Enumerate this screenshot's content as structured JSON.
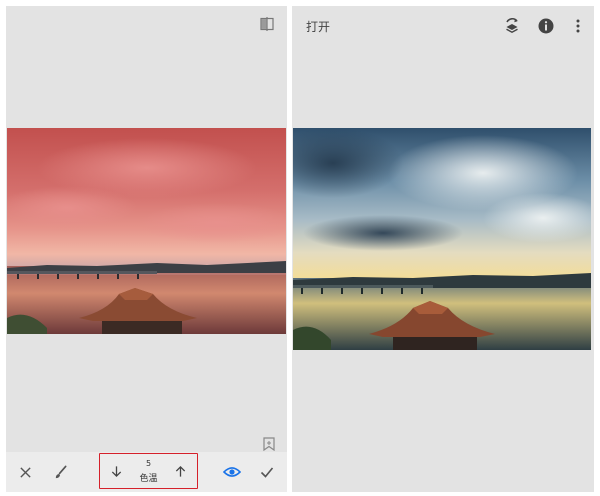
{
  "left_panel": {
    "tool": {
      "value": "5",
      "label": "色温"
    }
  },
  "right_panel": {
    "top_bar": {
      "open_label": "打开"
    }
  },
  "colors": {
    "panel_bg": "#e3e3e3",
    "accent_blue": "#1a73e8",
    "highlight_red": "#d5202a",
    "icon_gray": "#555555"
  },
  "icons": [
    "compare-icon",
    "bookmark-icon",
    "close-icon",
    "brush-icon",
    "arrow-down-icon",
    "arrow-up-icon",
    "eye-icon",
    "check-icon",
    "layers-undo-icon",
    "info-icon",
    "more-vert-icon"
  ]
}
